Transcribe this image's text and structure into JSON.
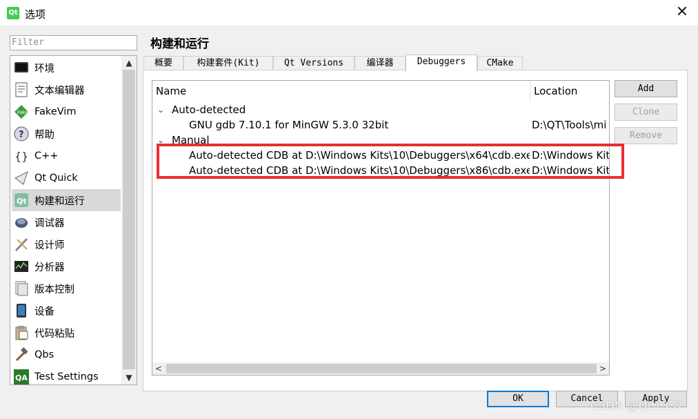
{
  "window": {
    "title": "选项",
    "app_logo": "Qt",
    "close_glyph": "✕"
  },
  "filter": {
    "placeholder": "Filter"
  },
  "nav": {
    "items": [
      {
        "label": "环境",
        "icon": "monitor-icon"
      },
      {
        "label": "文本编辑器",
        "icon": "text-editor-icon"
      },
      {
        "label": "FakeVim",
        "icon": "fakevim-icon"
      },
      {
        "label": "帮助",
        "icon": "help-icon"
      },
      {
        "label": "C++",
        "icon": "braces-icon"
      },
      {
        "label": "Qt Quick",
        "icon": "qt-quick-icon"
      },
      {
        "label": "构建和运行",
        "icon": "build-run-icon",
        "selected": true
      },
      {
        "label": "调试器",
        "icon": "debugger-icon"
      },
      {
        "label": "设计师",
        "icon": "designer-icon"
      },
      {
        "label": "分析器",
        "icon": "analyzer-icon"
      },
      {
        "label": "版本控制",
        "icon": "version-control-icon"
      },
      {
        "label": "设备",
        "icon": "device-icon"
      },
      {
        "label": "代码粘贴",
        "icon": "code-paste-icon"
      },
      {
        "label": "Qbs",
        "icon": "hammer-icon"
      },
      {
        "label": "Test Settings",
        "icon": "qa-icon"
      }
    ]
  },
  "page_title": "构建和运行",
  "tabs": [
    {
      "label": "概要"
    },
    {
      "label": "构建套件(Kit)"
    },
    {
      "label": "Qt Versions"
    },
    {
      "label": "编译器"
    },
    {
      "label": "Debuggers",
      "active": true
    },
    {
      "label": "CMake"
    }
  ],
  "debuggers": {
    "columns": {
      "name": "Name",
      "location": "Location"
    },
    "groups": [
      {
        "label": "Auto-detected",
        "expanded": true,
        "rows": [
          {
            "name": "GNU gdb 7.10.1 for MinGW 5.3.0 32bit",
            "location": "D:\\QT\\Tools\\mi"
          }
        ]
      },
      {
        "label": "Manual",
        "expanded": true,
        "rows": [
          {
            "name": "Auto-detected CDB at D:\\Windows Kits\\10\\Debuggers\\x64\\cdb.exe",
            "location": "D:\\Windows Kit"
          },
          {
            "name": "Auto-detected CDB at D:\\Windows Kits\\10\\Debuggers\\x86\\cdb.exe",
            "location": "D:\\Windows Kit"
          }
        ]
      }
    ]
  },
  "buttons": {
    "add": "Add",
    "clone": "Clone",
    "remove": "Remove"
  },
  "dialog_buttons": {
    "ok": "OK",
    "cancel": "Cancel",
    "apply": "Apply"
  },
  "watermark": "CSDN @QL1337",
  "colors": {
    "highlight": "#ec2c32",
    "selected_item_bg": "#d9d9d9",
    "default_button_border": "#0078d7",
    "qt_green": "#41cd52"
  }
}
